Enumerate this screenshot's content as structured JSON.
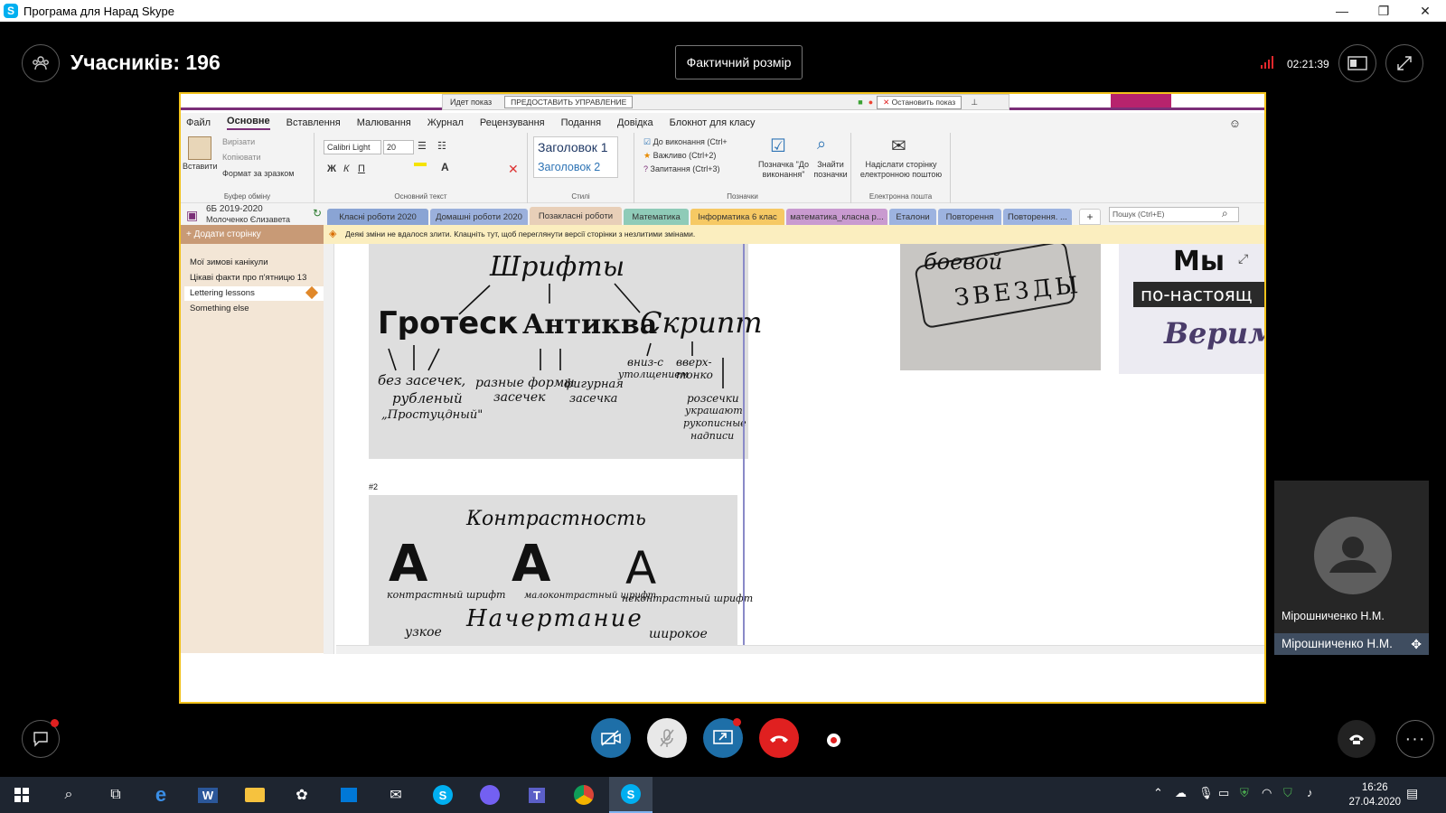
{
  "window": {
    "title": "Програма для Нарад Skype",
    "min": "—",
    "restore": "❐",
    "close": "✕"
  },
  "call": {
    "participants_label": "Учасників: 196",
    "actual_size_button": "Фактичний розмір",
    "timer": "02:21:39"
  },
  "share_bar": {
    "showing_label": "Идет показ",
    "grant_control": "ПРЕДОСТАВИТЬ УПРАВЛЕНИЕ",
    "stop_show": "Остановить показ"
  },
  "onenote": {
    "menu": [
      "Файл",
      "Основне",
      "Вставлення",
      "Малювання",
      "Журнал",
      "Рецензування",
      "Подання",
      "Довідка",
      "Блокнот для класу"
    ],
    "ribbon": {
      "paste": "Вставити",
      "cut": "Вирізати",
      "copy": "Копіювати",
      "format_painter": "Формат за зразком",
      "clipboard_group": "Буфер обміну",
      "font": "Calibri Light",
      "size": "20",
      "basic_text_group": "Основний текст",
      "heading1": "Заголовок 1",
      "heading2": "Заголовок 2",
      "styles_group": "Стилі",
      "tag_todo": "До виконання (Ctrl+",
      "tag_important": "Важливо (Ctrl+2)",
      "tag_question": "Запитання (Ctrl+3)",
      "todo_tag_btn": "Позначка \"До виконання\"",
      "find_tags_btn": "Знайти позначки",
      "tags_group": "Позначки",
      "send_page": "Надіслати сторінку електронною поштою",
      "email_group": "Електронна пошта"
    },
    "notebook": {
      "name": "6Б 2019-2020",
      "owner": "Молоченко Єлизавета"
    },
    "tabs": [
      "Класні роботи 2020",
      "Домашні роботи 2020",
      "Позакласні роботи",
      "Математика",
      "Інформатика 6 клас",
      "математика_класна р...",
      "Еталони",
      "Повторення",
      "Повторення. ..."
    ],
    "tab_colors": [
      "#8aa4d4",
      "#9bb0dc",
      "#e8cfb8",
      "#8fcbb8",
      "#f6c964",
      "#c99ad0",
      "#9db3e0",
      "#9db3e0",
      "#9db3e0"
    ],
    "add_tab": "+",
    "search_placeholder": "Пошук (Ctrl+E)",
    "add_page": "Додати сторінку",
    "warning": "Деякі зміни не вдалося злити. Клацніть тут, щоб переглянути версії сторінки з незлитими змінами.",
    "pages": [
      "Мої зимові канікули",
      "Цікаві факти про п'ятницю 13",
      "Lettering lessons",
      "Something else"
    ],
    "section_label": "#2"
  },
  "lettering1": {
    "title": "Шрифты",
    "grotesk": "Гротеск",
    "antiqua": "Антиква",
    "script": "Скрипт",
    "g_note1": "без засечек,",
    "g_note2": "рубленый",
    "g_note3": "„Простуцдный\"",
    "a_note1": "разные формы",
    "a_note2": "засечек",
    "a_note3": "фигурная",
    "a_note4": "засечка",
    "s_note1": "вниз-с",
    "s_note2": "утолщением",
    "s_note3": "вверх-",
    "s_note4": "тонко",
    "s_note5": "розсечки",
    "s_note6": "украшают",
    "s_note7": "рукописные",
    "s_note8": "надписи"
  },
  "lettering2": {
    "title": "Контрастность",
    "letter": "A",
    "c1": "контрастный шрифт",
    "c2": "малоконтрастный шрифт",
    "c3": "неконтрастный шрифт",
    "style": "Начертание",
    "narrow": "узкое",
    "wide": "широкое"
  },
  "photos": {
    "stars": "ЗВЕЗДЫ",
    "stars_top": "боевой",
    "we": "Мы",
    "really": "по-настоящ",
    "believe": "Верим"
  },
  "participant": {
    "name": "Мірошниченко Н.М."
  },
  "taskbar": {
    "time": "16:26",
    "date": "27.04.2020"
  }
}
